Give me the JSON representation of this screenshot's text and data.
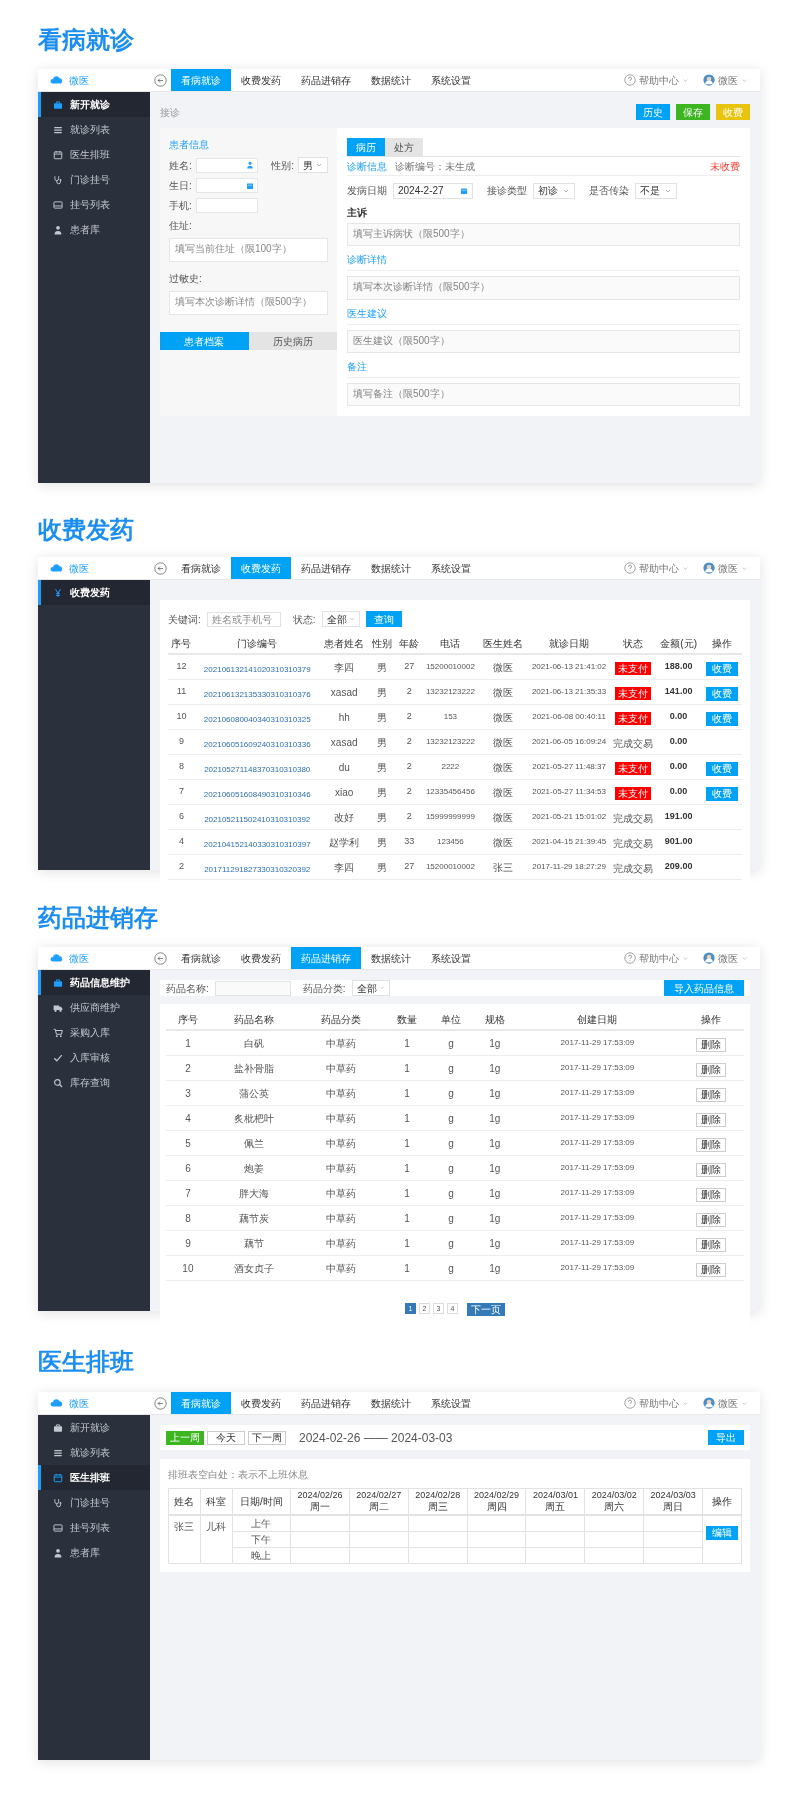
{
  "consult": {
    "heading": "看病就诊",
    "app": {
      "brand": "微医",
      "nav": [
        {
          "label": "看病就诊",
          "selected": true
        },
        {
          "label": "收费发药",
          "selected": false
        },
        {
          "label": "药品进销存",
          "selected": false
        },
        {
          "label": "数据统计",
          "selected": false
        },
        {
          "label": "系统设置",
          "selected": false
        }
      ],
      "help": "帮助中心",
      "user": "微医",
      "sidebar": [
        {
          "label": "新开就诊",
          "selected": true
        },
        {
          "label": "就诊列表",
          "selected": false
        },
        {
          "label": "医生排班",
          "selected": false
        },
        {
          "label": "门诊挂号",
          "selected": false
        },
        {
          "label": "挂号列表",
          "selected": false
        },
        {
          "label": "患者库",
          "selected": false
        }
      ]
    },
    "breadcrumb": "接诊",
    "actions": [
      {
        "label": "历史",
        "color": "#00a2f5"
      },
      {
        "label": "保存",
        "color": "#3cb521"
      },
      {
        "label": "收费",
        "color": "#e8c40f"
      }
    ],
    "patient": {
      "title": "患者信息",
      "name_label": "姓名:",
      "gender_label": "性别:",
      "gender": "男",
      "birthday_label": "生日:",
      "phone_label": "手机:",
      "address_label": "住址:",
      "address_placeholder": "填写当前住址（限100字）",
      "allergy_label": "过敏史:",
      "allergy_placeholder": "填写本次诊断详情（限500字）",
      "tabs": [
        {
          "label": "患者档案",
          "selected": true
        },
        {
          "label": "历史病历",
          "selected": false
        }
      ]
    },
    "record": {
      "tabs": [
        {
          "label": "病历",
          "selected": true
        },
        {
          "label": "处方",
          "selected": false
        }
      ],
      "info_label": "诊断信息",
      "number": "诊断编号：未生成",
      "charge_status": "未收费",
      "onset_label": "发病日期",
      "onset": "2024-2-27",
      "type_label": "接诊类型",
      "type": "初诊",
      "infectious_label": "是否传染",
      "infectious": "不是",
      "sections": [
        {
          "label": "主诉",
          "kind": "plain",
          "placeholder": "填写主诉病状（限500字）"
        },
        {
          "label": "诊断详情",
          "kind": "heading",
          "placeholder": "填写本次诊断详情（限500字）"
        },
        {
          "label": "医生建议",
          "kind": "heading",
          "placeholder": "医生建议（限500字）"
        },
        {
          "label": "备注",
          "kind": "heading",
          "placeholder": "填写备注（限500字）"
        }
      ]
    }
  },
  "billing": {
    "heading": "收费发药",
    "app": {
      "brand": "微医",
      "nav": [
        {
          "label": "看病就诊",
          "selected": false
        },
        {
          "label": "收费发药",
          "selected": true
        },
        {
          "label": "药品进销存",
          "selected": false
        },
        {
          "label": "数据统计",
          "selected": false
        },
        {
          "label": "系统设置",
          "selected": false
        }
      ],
      "help": "帮助中心",
      "user": "微医",
      "sidebar": [
        {
          "label": "收费发药",
          "selected": true
        }
      ]
    },
    "filter": {
      "keyword_label": "关键词:",
      "keyword_placeholder": "姓名或手机号",
      "status_label": "状态:",
      "status": "全部",
      "button": "查询"
    },
    "columns": [
      "序号",
      "门诊编号",
      "患者姓名",
      "性别",
      "年龄",
      "电话",
      "医生姓名",
      "就诊日期",
      "状态",
      "金额(元)",
      "操作"
    ],
    "rows": [
      {
        "no": "12",
        "id": "202106132141020310310379",
        "name": "李四",
        "gender": "男",
        "age": "27",
        "phone": "15200010002",
        "doctor": "微医",
        "date": "2021-06-13 21:41:02",
        "status": "未支付",
        "paid": false,
        "amount": "188.00",
        "action": "收费"
      },
      {
        "no": "11",
        "id": "202106132135330310310376",
        "name": "xasad",
        "gender": "男",
        "age": "2",
        "phone": "13232123222",
        "doctor": "微医",
        "date": "2021-06-13 21:35:33",
        "status": "未支付",
        "paid": false,
        "amount": "141.00",
        "action": "收费"
      },
      {
        "no": "10",
        "id": "202106080040340310310325",
        "name": "hh",
        "gender": "男",
        "age": "2",
        "phone": "153",
        "doctor": "微医",
        "date": "2021-06-08 00:40:11",
        "status": "未支付",
        "paid": false,
        "amount": "0.00",
        "action": "收费"
      },
      {
        "no": "9",
        "id": "202106051609240310310336",
        "name": "xasad",
        "gender": "男",
        "age": "2",
        "phone": "13232123222",
        "doctor": "微医",
        "date": "2021-06-05 16:09:24",
        "status": "完成交易",
        "paid": true,
        "amount": "0.00"
      },
      {
        "no": "8",
        "id": "202105271148370310310380",
        "name": "du",
        "gender": "男",
        "age": "2",
        "phone": "2222",
        "doctor": "微医",
        "date": "2021-05-27 11:48:37",
        "status": "未支付",
        "paid": false,
        "amount": "0.00",
        "action": "收费"
      },
      {
        "no": "7",
        "id": "202106051608490310310346",
        "name": "xiao",
        "gender": "男",
        "age": "2",
        "phone": "12335456456",
        "doctor": "微医",
        "date": "2021-05-27 11:34:53",
        "status": "未支付",
        "paid": false,
        "amount": "0.00",
        "action": "收费"
      },
      {
        "no": "6",
        "id": "202105211502410310310392",
        "name": "改好",
        "gender": "男",
        "age": "2",
        "phone": "15999999999",
        "doctor": "微医",
        "date": "2021-05-21 15:01:02",
        "status": "完成交易",
        "paid": true,
        "amount": "191.00"
      },
      {
        "no": "4",
        "id": "202104152140330310310397",
        "name": "赵学利",
        "gender": "男",
        "age": "33",
        "phone": "123456",
        "doctor": "微医",
        "date": "2021-04-15 21:39:45",
        "status": "完成交易",
        "paid": true,
        "amount": "901.00"
      },
      {
        "no": "2",
        "id": "201711291827330310320392",
        "name": "李四",
        "gender": "男",
        "age": "27",
        "phone": "15200010002",
        "doctor": "张三",
        "date": "2017-11-29 18:27:29",
        "status": "完成交易",
        "paid": true,
        "amount": "209.00"
      }
    ]
  },
  "pharmacy": {
    "heading": "药品进销存",
    "app": {
      "brand": "微医",
      "nav": [
        {
          "label": "看病就诊",
          "selected": false
        },
        {
          "label": "收费发药",
          "selected": false
        },
        {
          "label": "药品进销存",
          "selected": true
        },
        {
          "label": "数据统计",
          "selected": false
        },
        {
          "label": "系统设置",
          "selected": false
        }
      ],
      "help": "帮助中心",
      "user": "微医",
      "sidebar": [
        {
          "label": "药品信息维护",
          "selected": true
        },
        {
          "label": "供应商维护",
          "selected": false
        },
        {
          "label": "采购入库",
          "selected": false
        },
        {
          "label": "入库审核",
          "selected": false
        },
        {
          "label": "库存查询",
          "selected": false
        }
      ]
    },
    "filter": {
      "name_label": "药品名称:",
      "category_label": "药品分类:",
      "category": "全部",
      "button": "导入药品信息"
    },
    "columns": [
      "序号",
      "药品名称",
      "药品分类",
      "数量",
      "单位",
      "规格",
      "创建日期",
      "操作"
    ],
    "rows": [
      {
        "cells": [
          "1",
          "白矾",
          "中草药",
          "1",
          "g",
          "1g",
          "2017-11-29 17:53:09"
        ],
        "action": "删除"
      },
      {
        "cells": [
          "2",
          "盐补骨脂",
          "中草药",
          "1",
          "g",
          "1g",
          "2017-11-29 17:53:09"
        ],
        "action": "删除"
      },
      {
        "cells": [
          "3",
          "蒲公英",
          "中草药",
          "1",
          "g",
          "1g",
          "2017-11-29 17:53:09"
        ],
        "action": "删除"
      },
      {
        "cells": [
          "4",
          "炙枇杷叶",
          "中草药",
          "1",
          "g",
          "1g",
          "2017-11-29 17:53:09"
        ],
        "action": "删除"
      },
      {
        "cells": [
          "5",
          "佩兰",
          "中草药",
          "1",
          "g",
          "1g",
          "2017-11-29 17:53:09"
        ],
        "action": "删除"
      },
      {
        "cells": [
          "6",
          "炮姜",
          "中草药",
          "1",
          "g",
          "1g",
          "2017-11-29 17:53:09"
        ],
        "action": "删除"
      },
      {
        "cells": [
          "7",
          "胖大海",
          "中草药",
          "1",
          "g",
          "1g",
          "2017-11-29 17:53:09"
        ],
        "action": "删除"
      },
      {
        "cells": [
          "8",
          "藕节炭",
          "中草药",
          "1",
          "g",
          "1g",
          "2017-11-29 17:53:09"
        ],
        "action": "删除"
      },
      {
        "cells": [
          "9",
          "藕节",
          "中草药",
          "1",
          "g",
          "1g",
          "2017-11-29 17:53:09"
        ],
        "action": "删除"
      },
      {
        "cells": [
          "10",
          "酒女贞子",
          "中草药",
          "1",
          "g",
          "1g",
          "2017-11-29 17:53:09"
        ],
        "action": "删除"
      }
    ],
    "pages": [
      {
        "label": "1",
        "selected": true
      },
      {
        "label": "2",
        "selected": false
      },
      {
        "label": "3",
        "selected": false
      },
      {
        "label": "4",
        "selected": false
      }
    ],
    "next": "下一页"
  },
  "schedule": {
    "heading": "医生排班",
    "app": {
      "brand": "微医",
      "nav": [
        {
          "label": "看病就诊",
          "selected": true
        },
        {
          "label": "收费发药",
          "selected": false
        },
        {
          "label": "药品进销存",
          "selected": false
        },
        {
          "label": "数据统计",
          "selected": false
        },
        {
          "label": "系统设置",
          "selected": false
        }
      ],
      "help": "帮助中心",
      "user": "微医",
      "sidebar": [
        {
          "label": "新开就诊",
          "selected": false
        },
        {
          "label": "就诊列表",
          "selected": false
        },
        {
          "label": "医生排班",
          "selected": true
        },
        {
          "label": "门诊挂号",
          "selected": false
        },
        {
          "label": "挂号列表",
          "selected": false
        },
        {
          "label": "患者库",
          "selected": false
        }
      ]
    },
    "buttons": [
      {
        "label": "上一周",
        "kind": "primary"
      },
      {
        "label": "今天",
        "kind": "default"
      },
      {
        "label": "下一周",
        "kind": "default"
      }
    ],
    "range": "2024-02-26 —— 2024-03-03",
    "export": "导出",
    "note": "排班表空白处：表示不上班休息",
    "columns": [
      "姓名",
      "科室",
      "日期/时间"
    ],
    "days": [
      {
        "date": "2024/02/26",
        "weekday": "周一"
      },
      {
        "date": "2024/02/27",
        "weekday": "周二"
      },
      {
        "date": "2024/02/28",
        "weekday": "周三"
      },
      {
        "date": "2024/02/29",
        "weekday": "周四"
      },
      {
        "date": "2024/03/01",
        "weekday": "周五"
      },
      {
        "date": "2024/03/02",
        "weekday": "周六"
      },
      {
        "date": "2024/03/03",
        "weekday": "周日"
      }
    ],
    "action_column": "操作",
    "rows": [
      {
        "name": "张三",
        "department": "儿科",
        "slots": [
          "上午",
          "下午",
          "晚上"
        ],
        "action": "编辑"
      }
    ]
  }
}
